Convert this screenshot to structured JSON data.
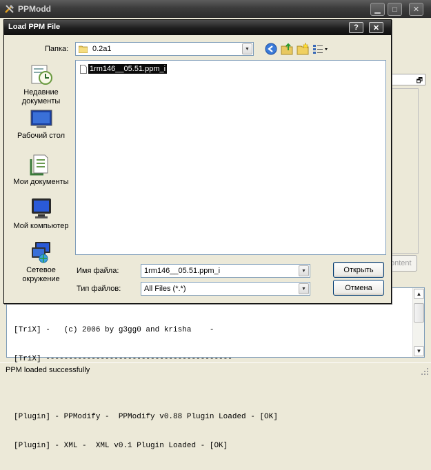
{
  "main_window": {
    "title": "PPModd",
    "content_button": "ontent",
    "log_lines": [
      "[TriX] -   (c) 2006 by g3gg0 and krisha    -",
      "[TriX] -----------------------------------------",
      "",
      "[Plugin] - PPModify -  PPModify v0.88 Plugin Loaded - [OK]",
      "[Plugin] - XML -  XML v0.1 Plugin Loaded - [OK]"
    ],
    "status": "PPM loaded successfully"
  },
  "dialog": {
    "title": "Load PPM File",
    "help_button": "?",
    "close_button": "✕",
    "folder_label": "Папка:",
    "folder_value": "0.2a1",
    "places": [
      {
        "label": "Недавние документы",
        "icon": "recent-documents-icon"
      },
      {
        "label": "Рабочий стол",
        "icon": "desktop-icon"
      },
      {
        "label": "Мои документы",
        "icon": "my-documents-icon"
      },
      {
        "label": "Мой компьютер",
        "icon": "my-computer-icon"
      },
      {
        "label": "Сетевое окружение",
        "icon": "network-places-icon"
      }
    ],
    "files": [
      "1rm146__05.51.ppm_i"
    ],
    "filename_label": "Имя файла:",
    "filename_value": "1rm146__05.51.ppm_i",
    "filetype_label": "Тип файлов:",
    "filetype_value": "All Files (*.*)",
    "open_button": "Открыть",
    "cancel_button": "Отмена"
  }
}
